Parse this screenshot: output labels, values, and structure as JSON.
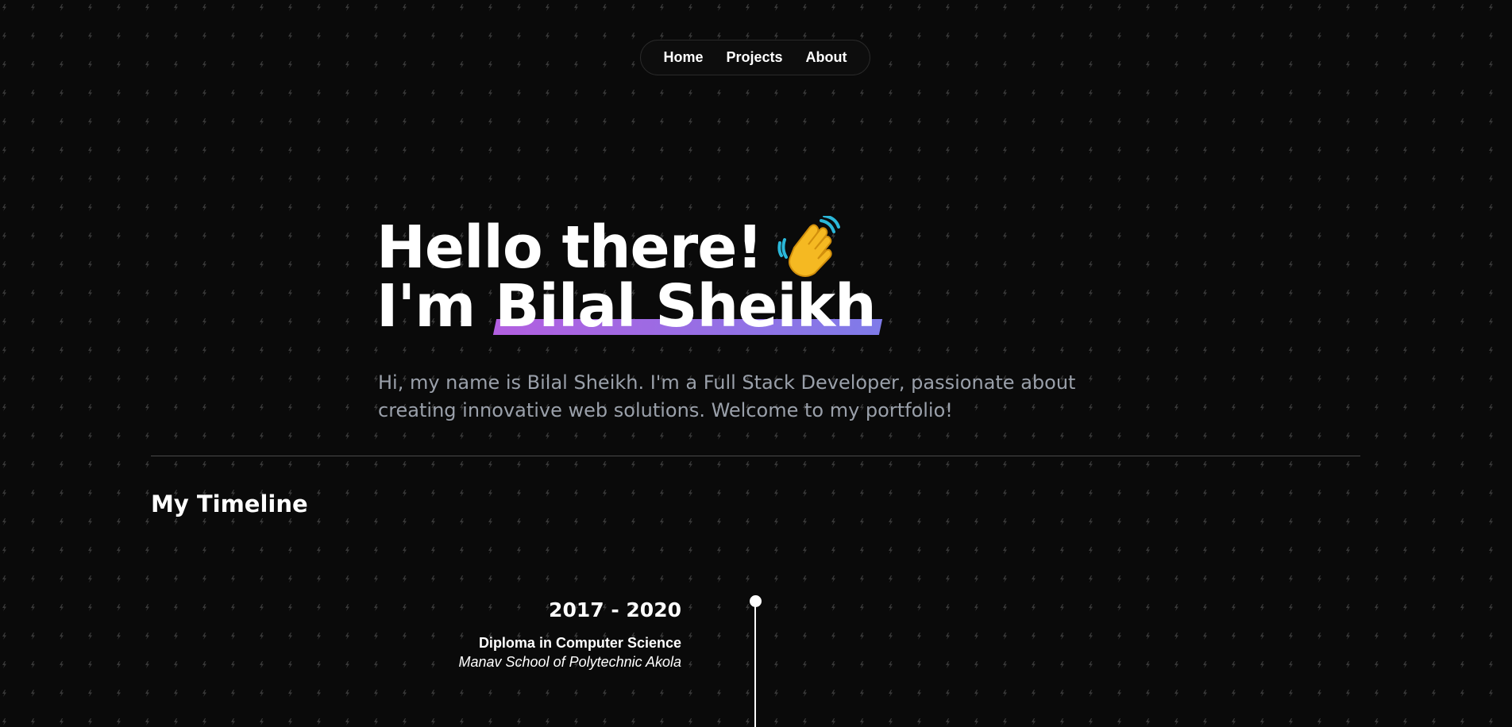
{
  "nav": {
    "items": [
      {
        "label": "Home"
      },
      {
        "label": "Projects"
      },
      {
        "label": "About"
      }
    ]
  },
  "hero": {
    "line1": "Hello there!",
    "line2_prefix": "I'm",
    "name": "Bilal Sheikh",
    "wave_icon": "waving-hand-icon",
    "intro": "Hi, my name is Bilal Sheikh. I'm a Full Stack Developer, passionate about creating innovative web solutions. Welcome to my portfolio!"
  },
  "timeline": {
    "title": "My Timeline",
    "entries": [
      {
        "years": "2017 - 2020",
        "degree": "Diploma in Computer Science",
        "school": "Manav School of Polytechnic Akola"
      }
    ]
  },
  "colors": {
    "background": "#0a0a0a",
    "text": "#ffffff",
    "muted_text": "#9aa0aa",
    "accent_gradient_start": "#b25fe0",
    "accent_gradient_end": "#7f7be8",
    "pattern": "#3a3a3a"
  }
}
